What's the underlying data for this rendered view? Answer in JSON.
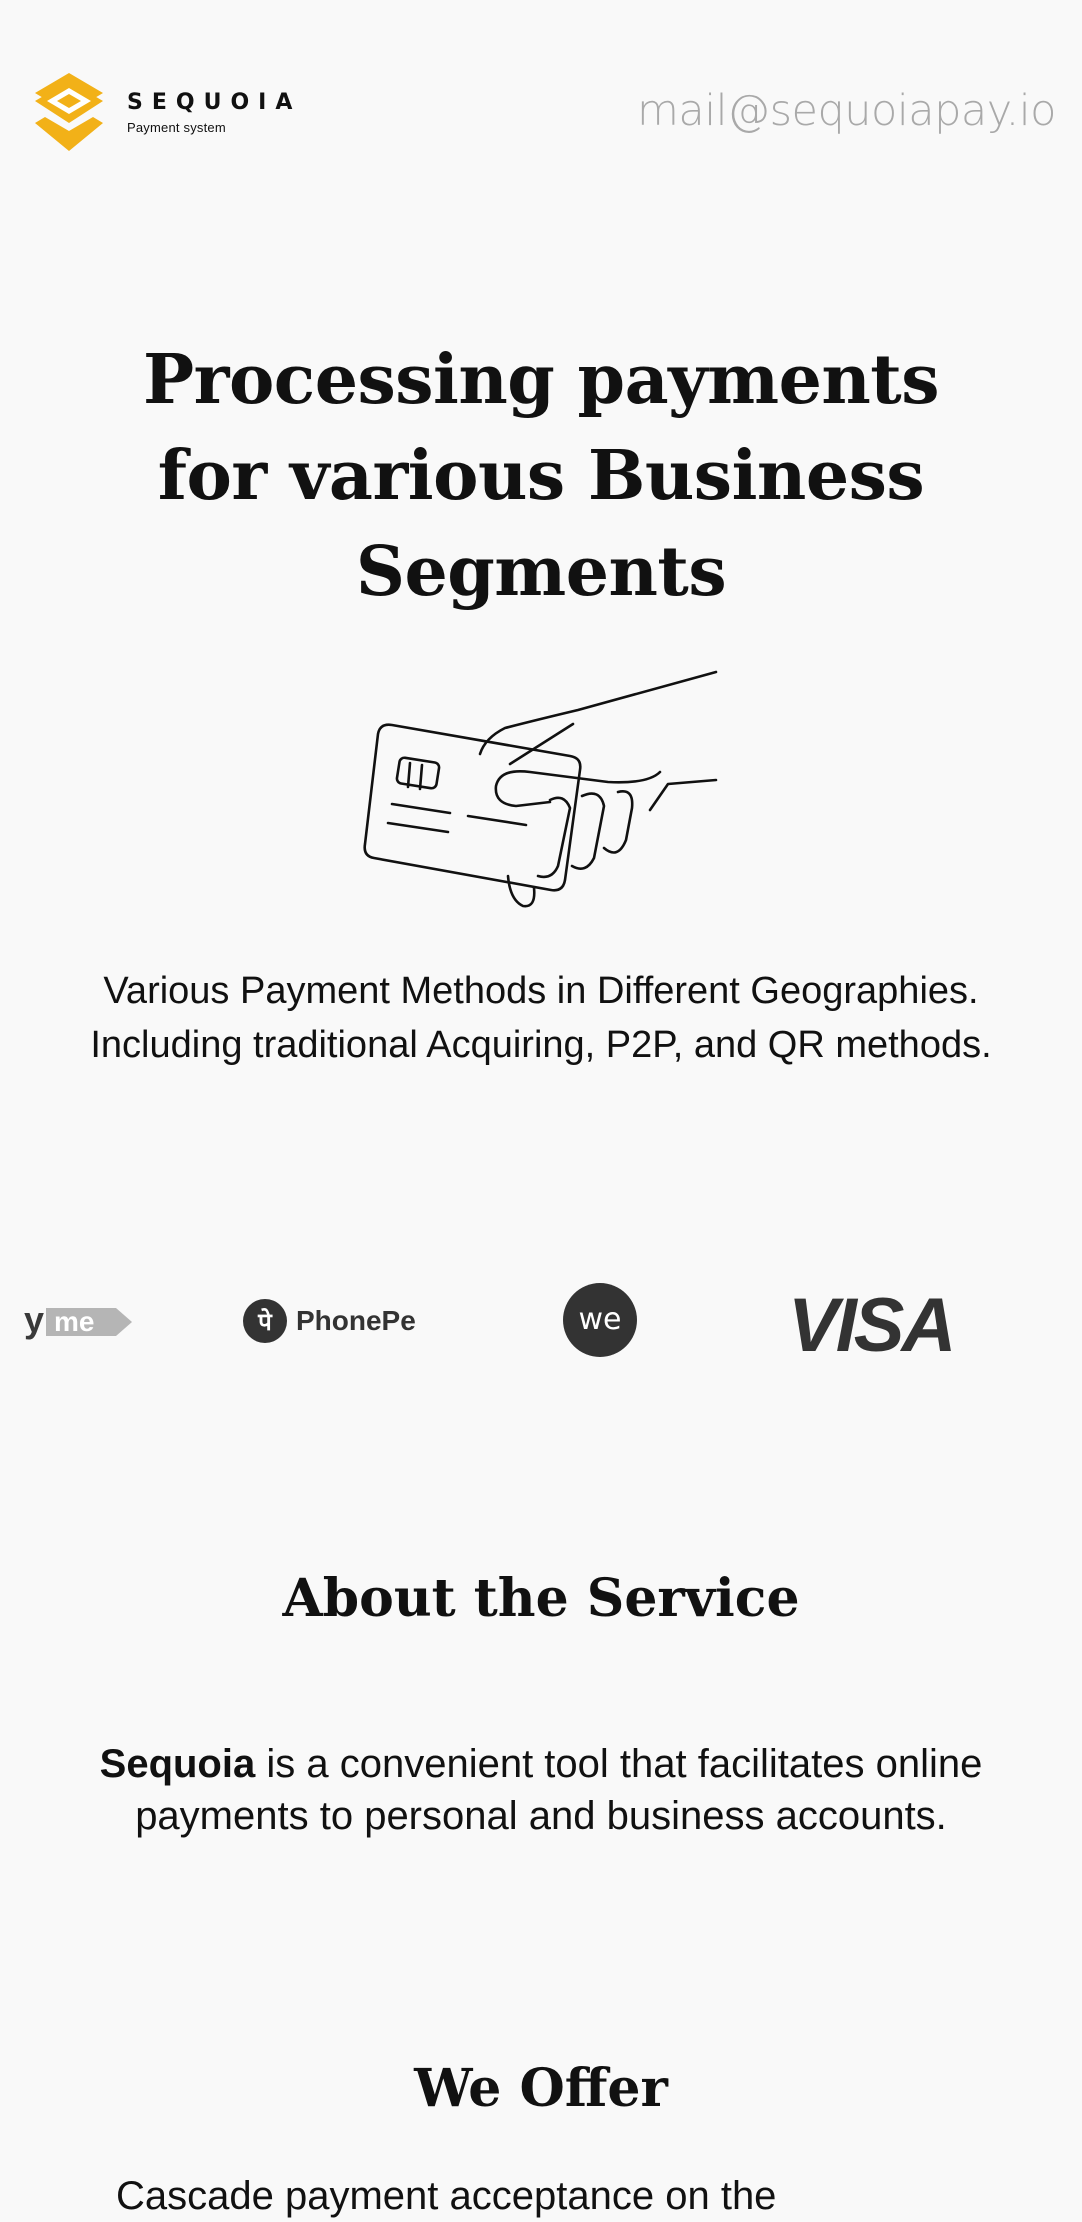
{
  "header": {
    "brand_name": "SEQUOIA",
    "brand_tagline": "Payment system",
    "email": "mail@sequoiapay.io",
    "brand_color": "#f2b118"
  },
  "hero": {
    "title_line1": "Processing payments",
    "title_line2": "for various Business",
    "title_line3": "Segments",
    "illustration": "hand-holding-card-icon",
    "subtitle_line1": "Various Payment Methods in Different Geographies.",
    "subtitle_line2": "Including traditional Acquiring, P2P, and QR methods."
  },
  "payment_logos": {
    "items": [
      {
        "icon": "yme-logo",
        "text": "yme"
      },
      {
        "icon": "phonepe-logo",
        "text": "PhonePe"
      },
      {
        "icon": "we-logo",
        "text": "we"
      },
      {
        "icon": "visa-logo",
        "text": "VISA"
      }
    ]
  },
  "about": {
    "title": "About the Service",
    "brand": "Sequoia",
    "text_line1_rest": " is a convenient tool that facilitates online",
    "text_line2": "payments to personal and business accounts."
  },
  "offer": {
    "title": "We Offer",
    "first_item_partial": "Cascade payment acceptance on the"
  }
}
